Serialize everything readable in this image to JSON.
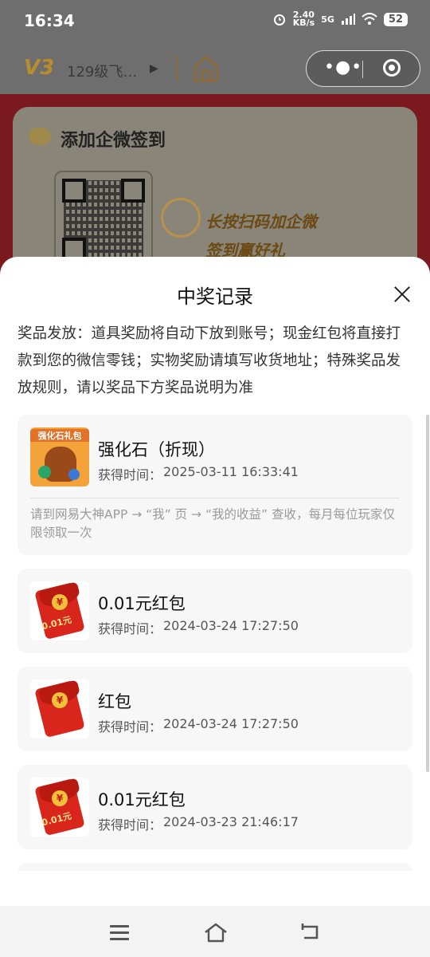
{
  "status_bar": {
    "time": "16:34",
    "speed_value": "2.40",
    "speed_unit": "KB/s",
    "network": "5G",
    "battery": "52"
  },
  "header": {
    "badge": "V3",
    "level_text": "129级飞…"
  },
  "background_card": {
    "title": "添加企微签到",
    "slogan_line1": "长按扫码加企微",
    "slogan_line2": "签到赢好礼"
  },
  "sheet": {
    "title": "中奖记录",
    "notice": "奖品发放：道具奖励将自动下放到账号；现金红包将直接打款到您的微信零钱；实物奖励请填写收货地址；特殊奖品发放规则，请以奖品下方奖品说明为准",
    "time_label": "获得时间：",
    "prizes": [
      {
        "name": "强化石（折现）",
        "time": "2025-03-11 16:33:41",
        "image_label": "强化石礼包",
        "desc": "请到网易大神APP →  “我”  页 →  “我的收益”  查收，每月每位玩家仅限领取一次"
      },
      {
        "name": "0.01元红包",
        "time": "2024-03-24 17:27:50",
        "packet_amount": "0.01元"
      },
      {
        "name": "红包",
        "time": "2024-03-24 17:27:50"
      },
      {
        "name": "0.01元红包",
        "time": "2024-03-23 21:46:17",
        "packet_amount": "0.01元"
      }
    ]
  },
  "icons": {
    "home": "home-icon",
    "more": "more-dots-icon",
    "close_mini": "target-icon",
    "close_sheet": "close-icon",
    "nav_menu": "menu-icon",
    "nav_home": "home-outline-icon",
    "nav_back": "back-icon"
  },
  "colors": {
    "sheet_bg": "#ffffff",
    "card_bg": "#f7f7f7",
    "red_packet": "#d9261c",
    "dim_overlay": "#6e6e6e"
  }
}
